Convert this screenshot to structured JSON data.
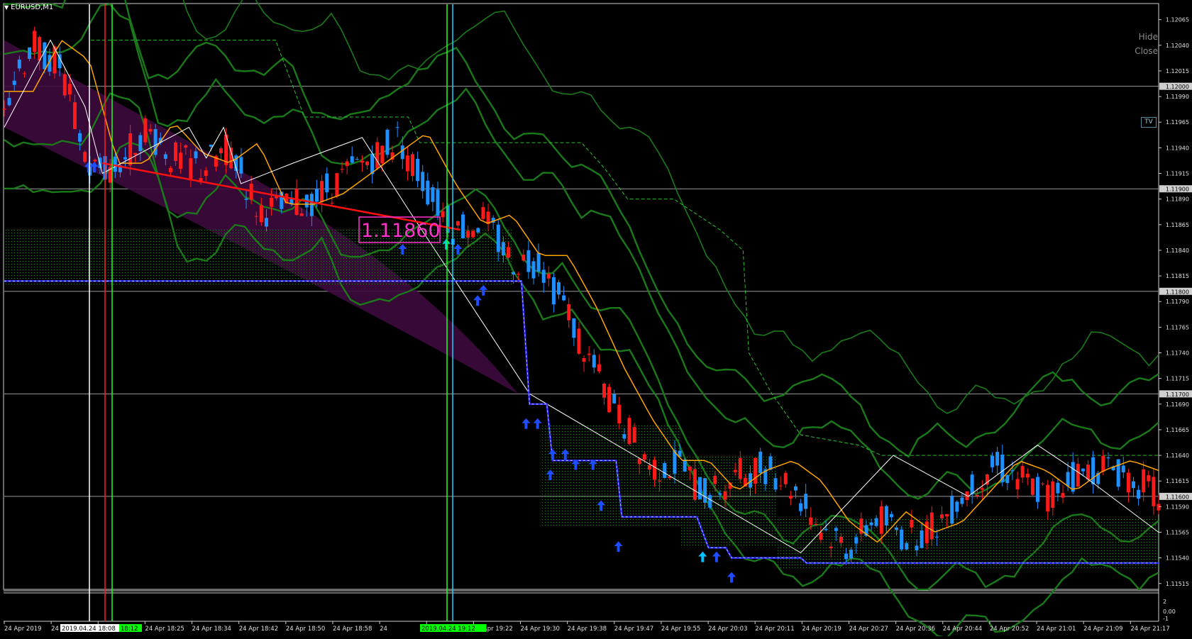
{
  "window": {
    "symbol": "EURUSD,M1",
    "hide_label": "Hide",
    "close_label": "Close",
    "tv_label": "TV"
  },
  "colors": {
    "background": "#000000",
    "bull": "#1e90ff",
    "bear": "#ff1a1a",
    "ma": "#ffa500",
    "bands": "#1a7a1a",
    "channel": "#3c0a3c",
    "support": "#2a2aff",
    "callout": "#ff33cc"
  },
  "icons": [
    "menu-triangle-icon",
    "up-arrow-icon"
  ],
  "chart_data": {
    "type": "candlestick",
    "symbol": "EURUSD",
    "timeframe": "M1",
    "ylim": [
      1.1151,
      1.1208
    ],
    "y_ticks": [
      "1.12065",
      "1.12040",
      "1.12015",
      "1.11990",
      "1.11965",
      "1.11940",
      "1.11915",
      "1.11890",
      "1.11865",
      "1.11840",
      "1.11815",
      "1.11790",
      "1.11765",
      "1.11740",
      "1.11715",
      "1.11690",
      "1.11665",
      "1.11640",
      "1.11615",
      "1.11590",
      "1.11565",
      "1.11540",
      "1.11515"
    ],
    "price_levels": [
      {
        "label": "1.12000",
        "value": 1.12
      },
      {
        "label": "1.11900",
        "value": 1.119
      },
      {
        "label": "1.11800",
        "value": 1.118
      },
      {
        "label": "1.11700",
        "value": 1.117
      },
      {
        "label": "1.11600",
        "value": 1.116
      }
    ],
    "x_ticks": [
      "24 Apr 2019",
      "24 A",
      "24 Apr 18:17",
      "24 Apr 18:25",
      "24 Apr 18:34",
      "24 Apr 18:42",
      "24 Apr 18:50",
      "24 Apr 18:58",
      "24",
      "19:14",
      "24 Apr 19:22",
      "24 Apr 19:30",
      "24 Apr 19:38",
      "24 Apr 19:47",
      "24 Apr 19:55",
      "24 Apr 20:03",
      "24 Apr 20:11",
      "24 Apr 20:19",
      "24 Apr 20:27",
      "24 Apr 20:36",
      "24 Apr 20:44",
      "24 Apr 20:52",
      "24 Apr 21:01",
      "24 Apr 21:09",
      "24 Apr 21:17"
    ],
    "vertical_markers": [
      {
        "label": "2019.04.24 18:08",
        "color": "#ffffff"
      },
      {
        "label": "18:12",
        "color": "#00ff00"
      },
      {
        "label": "2019.04.24 19:12",
        "color": "#00ff00"
      }
    ],
    "callout": "1.11860",
    "sub_window_ticks": [
      "2",
      "0.00",
      "-1"
    ],
    "close_path": [
      1.1199,
      1.1204,
      1.1202,
      1.1192,
      1.1192,
      1.1196,
      1.1193,
      1.1192,
      1.1194,
      1.1188,
      1.1188,
      1.1189,
      1.1191,
      1.1193,
      1.1195,
      1.119,
      1.1186,
      1.1187,
      1.1183,
      1.1183,
      1.1178,
      1.1172,
      1.1167,
      1.1163,
      1.1163,
      1.116,
      1.1162,
      1.1163,
      1.1161,
      1.1157,
      1.1155,
      1.1158,
      1.1156,
      1.1157,
      1.116,
      1.1163,
      1.1162,
      1.116,
      1.1162,
      1.1163,
      1.1162,
      1.116
    ]
  }
}
